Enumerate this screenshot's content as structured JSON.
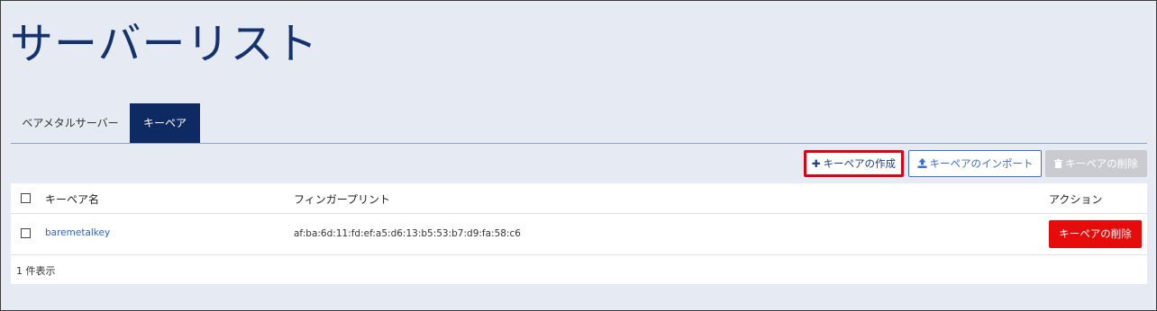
{
  "page": {
    "title": "サーバーリスト"
  },
  "tabs": [
    {
      "label": "ベアメタルサーバー",
      "active": false
    },
    {
      "label": "キーペア",
      "active": true
    }
  ],
  "toolbar": {
    "create_label": "キーペアの作成",
    "create_icon": "plus-icon",
    "import_label": "キーペアのインポート",
    "import_icon": "upload-icon",
    "delete_label": "キーペアの削除",
    "delete_icon": "trash-icon"
  },
  "table": {
    "columns": [
      "キーペア名",
      "フィンガープリント",
      "アクション"
    ],
    "rows": [
      {
        "name": "baremetalkey",
        "fingerprint": "af:ba:6d:11:fd:ef:a5:d6:13:b5:53:b7:d9:fa:58:c6",
        "action_label": "キーペアの削除"
      }
    ],
    "footer": "1 件表示"
  },
  "colors": {
    "title": "#14336e",
    "active_tab": "#0e2a63",
    "highlight_border": "#e00010",
    "danger": "#e60c0c",
    "link": "#2e62c9",
    "background": "#e6eaf2"
  }
}
